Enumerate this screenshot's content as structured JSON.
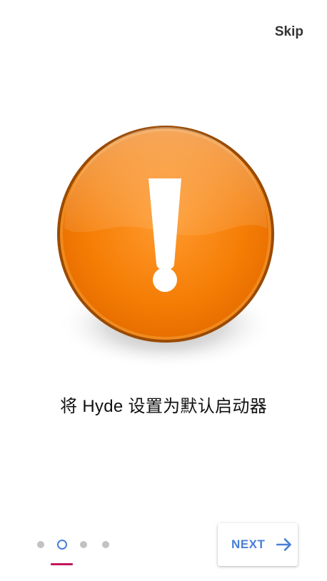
{
  "header": {
    "skip_label": "Skip"
  },
  "main": {
    "illustration_icon": "orange-exclamation-warning-icon",
    "message": "将 Hyde 设置为默认启动器"
  },
  "footer": {
    "page_count": 4,
    "active_page": 2,
    "next_label": "NEXT",
    "next_icon": "arrow-right-icon"
  },
  "colors": {
    "accent": "#4a7fd8",
    "indicator": "#c2185b",
    "dot_inactive": "#c2c2c2",
    "warning_orange": "#f47b00"
  }
}
